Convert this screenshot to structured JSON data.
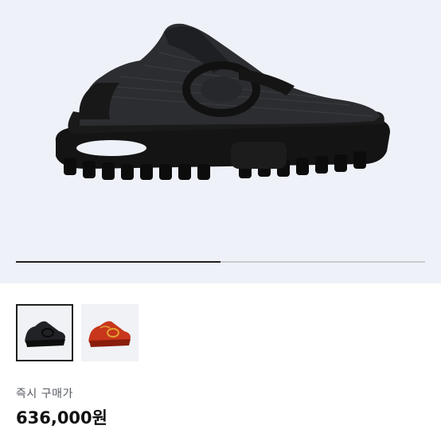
{
  "product": {
    "image_icon": "black-sneaker",
    "gallery": {
      "progress_fraction": 0.5,
      "thumbnails": [
        {
          "icon": "black-sneaker-thumbnail",
          "selected": true
        },
        {
          "icon": "red-sneaker-thumbnail",
          "selected": false
        }
      ]
    },
    "price": {
      "label": "즉시 구매가",
      "value": "636,000원"
    }
  },
  "colors": {
    "hero_bg": "#eef1f7",
    "thumb_red": "#c8361b",
    "text_dark": "#111111"
  }
}
